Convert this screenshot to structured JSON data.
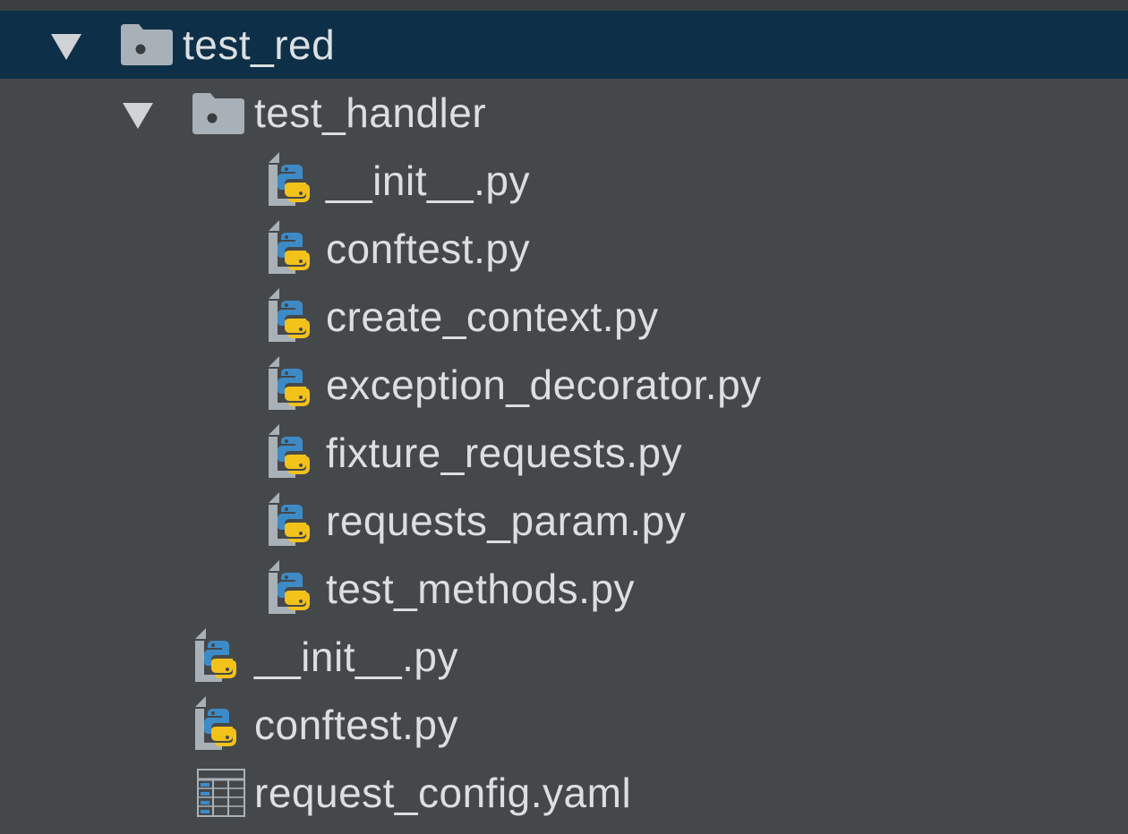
{
  "tree": {
    "root": {
      "label": "test_red",
      "icon": "folder-icon",
      "expanded": true,
      "selected": true
    },
    "subfolder": {
      "label": "test_handler",
      "icon": "folder-icon",
      "expanded": true
    },
    "subfolder_files": [
      {
        "label": "__init__.py",
        "icon": "python-file-icon"
      },
      {
        "label": "conftest.py",
        "icon": "python-file-icon"
      },
      {
        "label": "create_context.py",
        "icon": "python-file-icon"
      },
      {
        "label": "exception_decorator.py",
        "icon": "python-file-icon"
      },
      {
        "label": "fixture_requests.py",
        "icon": "python-file-icon"
      },
      {
        "label": "requests_param.py",
        "icon": "python-file-icon"
      },
      {
        "label": "test_methods.py",
        "icon": "python-file-icon"
      }
    ],
    "root_files": [
      {
        "label": "__init__.py",
        "icon": "python-file-icon"
      },
      {
        "label": "conftest.py",
        "icon": "python-file-icon"
      },
      {
        "label": "request_config.yaml",
        "icon": "yaml-file-icon"
      }
    ]
  },
  "colors": {
    "background": "#45484b",
    "selection": "#0d2f47",
    "text": "#dcdfe2",
    "folder": "#a9b1b8",
    "python_blue": "#3d8bc6",
    "python_yellow": "#f2c21b"
  }
}
